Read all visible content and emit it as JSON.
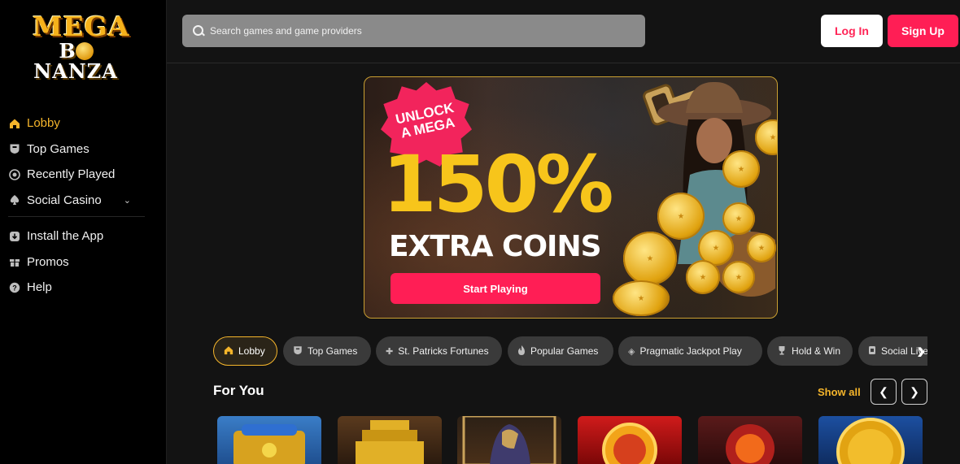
{
  "brand": {
    "logo_line1": "MEGA",
    "logo_line2": "BONANZA"
  },
  "sidebar": {
    "items": [
      {
        "label": "Lobby",
        "icon": "home-icon",
        "active": true
      },
      {
        "label": "Top Games",
        "icon": "shield-icon"
      },
      {
        "label": "Recently Played",
        "icon": "clock-icon"
      },
      {
        "label": "Social Casino",
        "icon": "spade-icon",
        "expandable": true
      }
    ],
    "items2": [
      {
        "label": "Install the App",
        "icon": "download-icon"
      },
      {
        "label": "Promos",
        "icon": "gift-icon"
      },
      {
        "label": "Help",
        "icon": "help-icon"
      }
    ]
  },
  "header": {
    "search_placeholder": "Search games and game providers",
    "login_label": "Log In",
    "signup_label": "Sign Up"
  },
  "banner": {
    "badge": "UNLOCK\nA MEGA",
    "badge_line1": "UNLOCK",
    "badge_line2": "A MEGA",
    "headline": "150%",
    "subheadline": "EXTRA COINS",
    "cta": "Start Playing"
  },
  "categories": [
    {
      "label": "Lobby",
      "icon": "home-icon",
      "active": true
    },
    {
      "label": "Top Games",
      "icon": "shield-icon"
    },
    {
      "label": "St. Patricks Fortunes",
      "icon": "clover-icon"
    },
    {
      "label": "Popular Games",
      "icon": "flame-icon"
    },
    {
      "label": "Pragmatic Jackpot Play",
      "icon": "diamond-icon"
    },
    {
      "label": "Hold & Win",
      "icon": "trophy-icon"
    },
    {
      "label": "Social Live",
      "icon": "cards-icon"
    }
  ],
  "section": {
    "title": "For You",
    "show_all": "Show all"
  },
  "colors": {
    "accent": "#f5b52b",
    "brand_red": "#ff1e55",
    "background": "#131313"
  }
}
